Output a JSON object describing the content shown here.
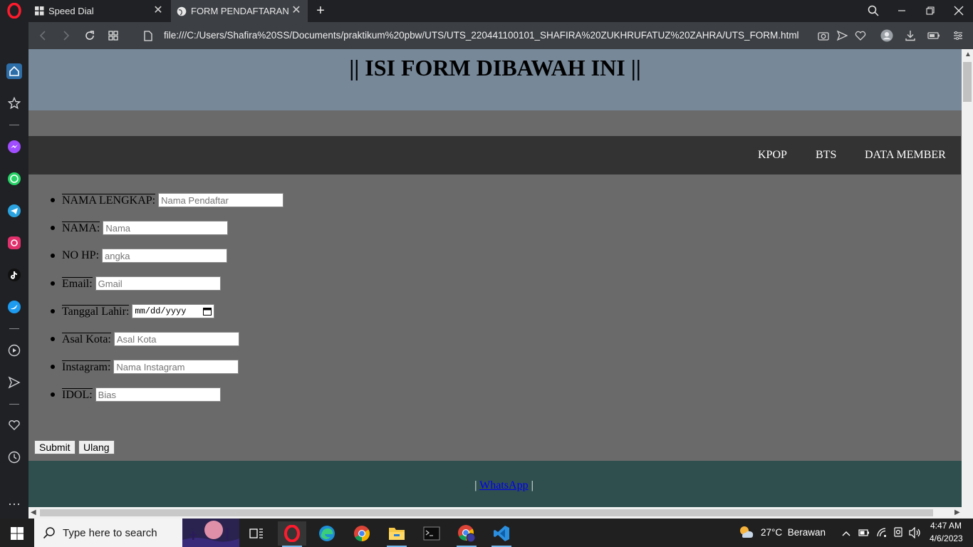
{
  "browser": {
    "tabs": [
      {
        "title": "Speed Dial"
      },
      {
        "title": "FORM PENDAFTARAN"
      }
    ],
    "url": "file:///C:/Users/Shafira%20SS/Documents/praktikum%20pbw/UTS/UTS_220441100101_SHAFIRA%20ZUKHRUFATUZ%20ZAHRA/UTS_FORM.html"
  },
  "page": {
    "header_title": "|| ISI FORM DIBAWAH INI ||",
    "nav": [
      "KPOP",
      "BTS",
      "DATA MEMBER"
    ],
    "form_fields": [
      {
        "label": "NAMA LENGKAP:",
        "placeholder": "Nama Pendaftar",
        "type": "text"
      },
      {
        "label": "NAMA:",
        "placeholder": "Nama",
        "type": "text"
      },
      {
        "label": "NO HP:",
        "placeholder": "angka",
        "type": "text"
      },
      {
        "label": "Email:",
        "placeholder": "Gmail",
        "type": "text"
      },
      {
        "label": "Tanggal Lahir:",
        "placeholder": "mm/dd/yyyy",
        "type": "date"
      },
      {
        "label": "Asal Kota:",
        "placeholder": "Asal Kota",
        "type": "text"
      },
      {
        "label": "Instagram:",
        "placeholder": "Nama Instagram",
        "type": "text"
      },
      {
        "label": "IDOL:",
        "placeholder": "Bias",
        "type": "text"
      }
    ],
    "buttons": {
      "submit": "Submit",
      "reset": "Ulang"
    },
    "footer": {
      "pre": "| ",
      "link": "WhatsApp",
      "post": " |"
    }
  },
  "taskbar": {
    "search_placeholder": "Type here to search",
    "weather_temp": "27°C",
    "weather_desc": "Berawan",
    "time": "4:47 AM",
    "date": "4/6/2023"
  },
  "colors": {
    "header_bg": "#778899",
    "nav_bg": "#333333",
    "page_bg": "#6a6a6a",
    "footer_bg": "#2f4f4f"
  }
}
